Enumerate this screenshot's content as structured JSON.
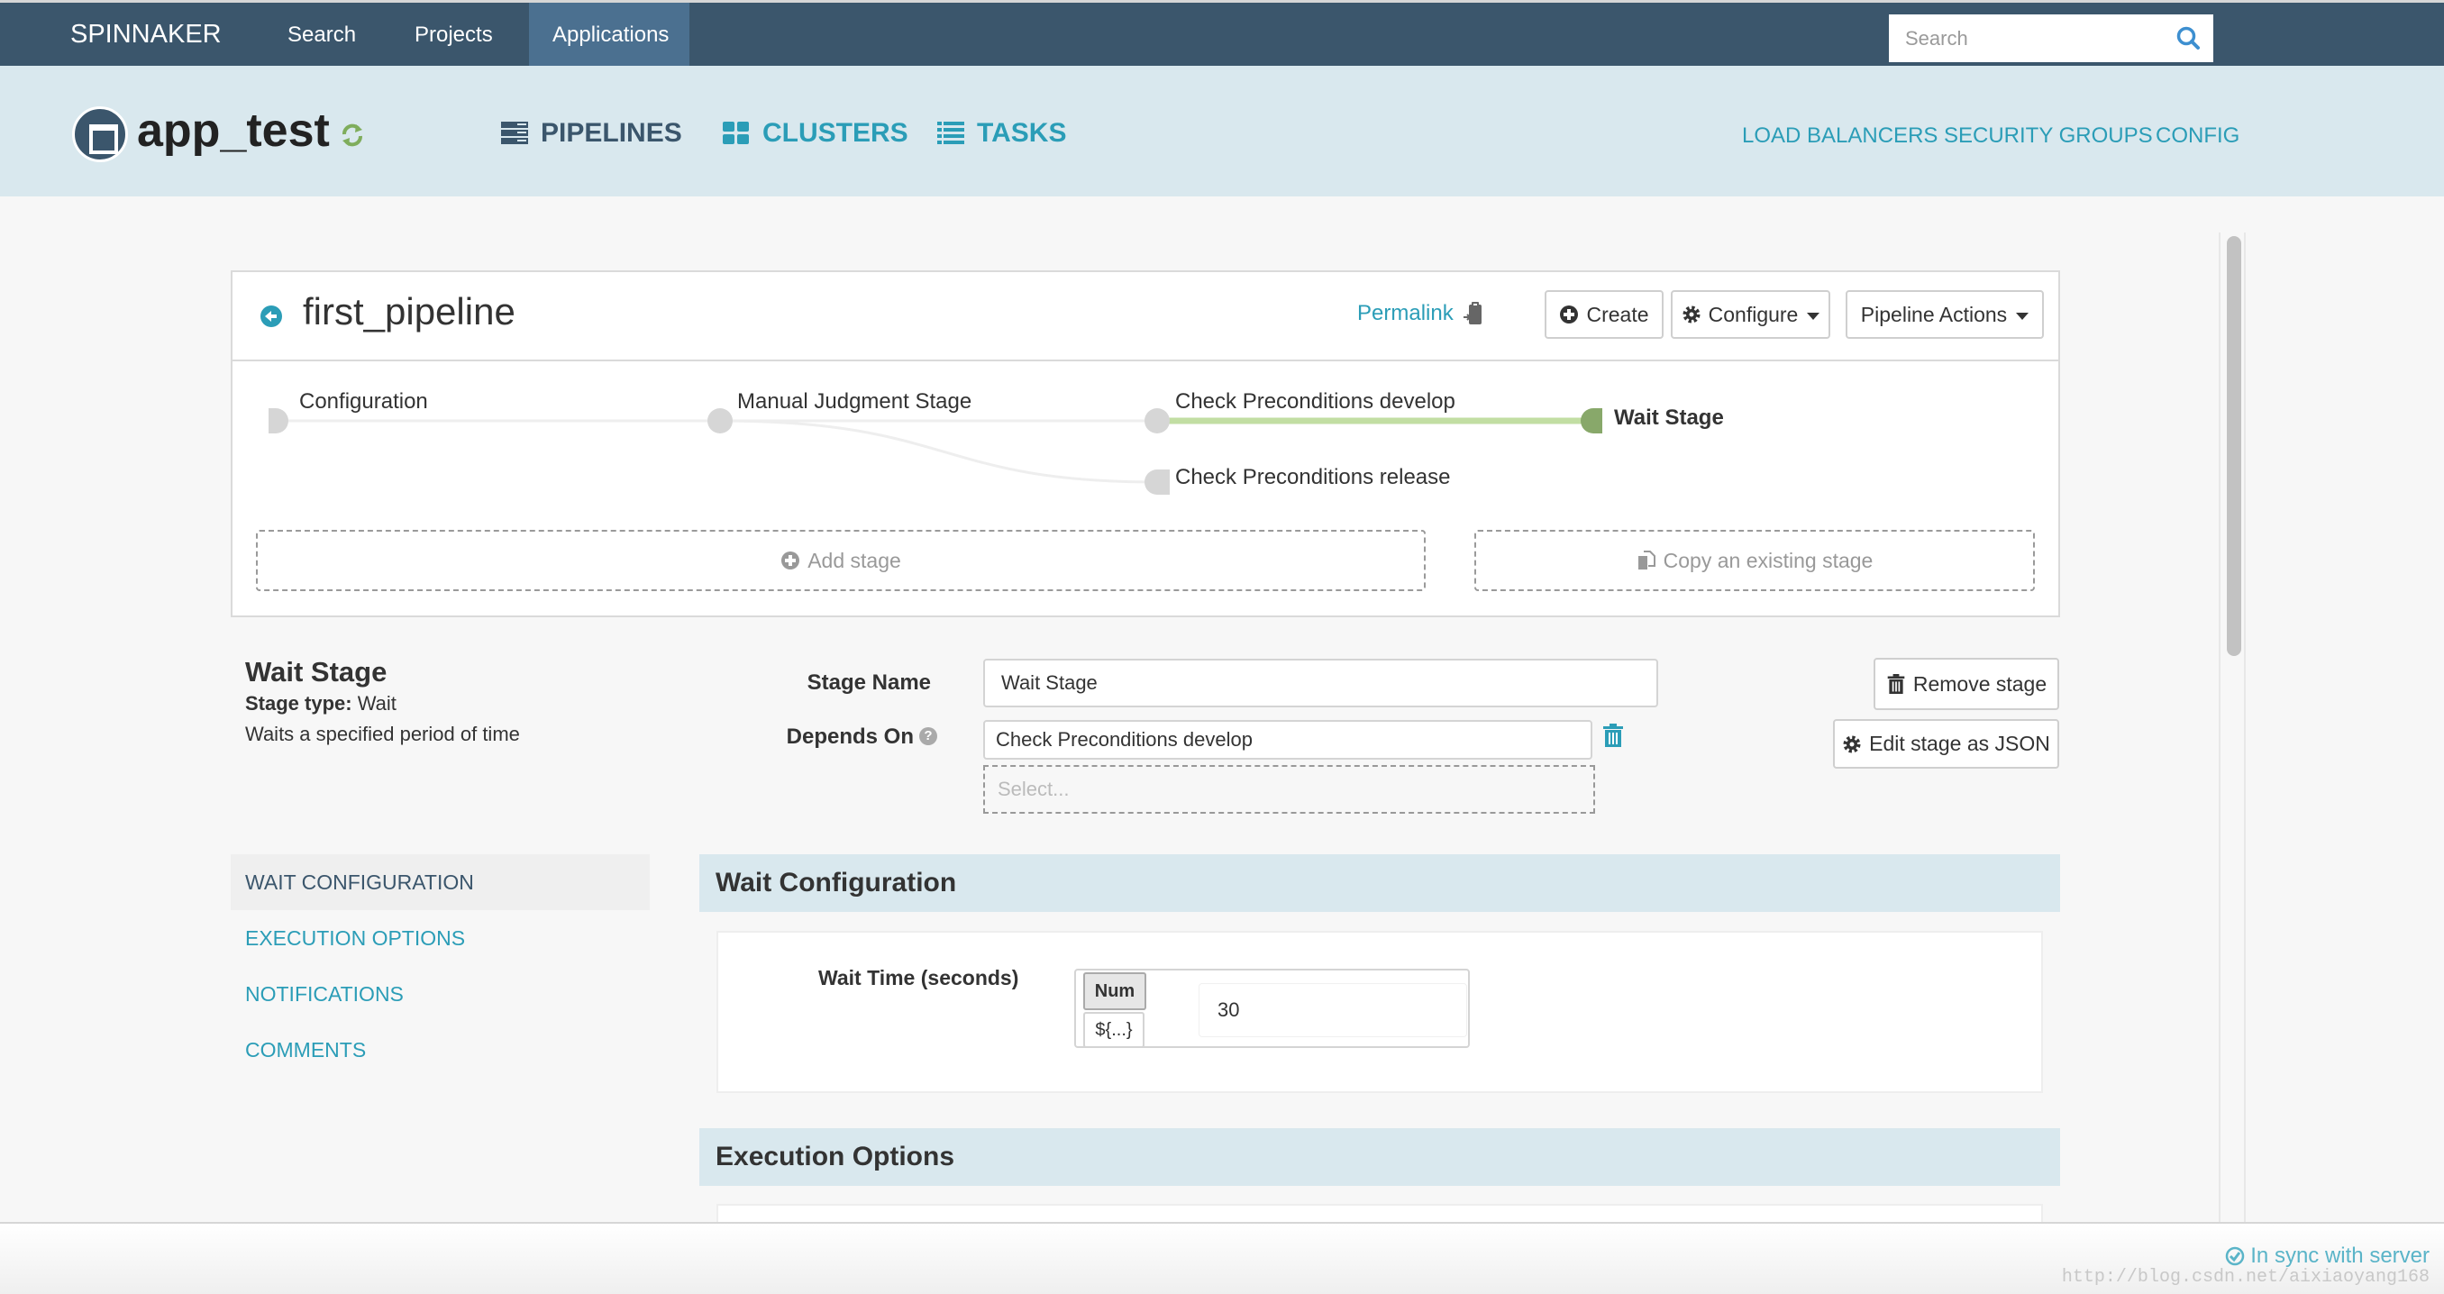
{
  "topnav": {
    "brand": "SPINNAKER",
    "links": [
      {
        "label": "Search"
      },
      {
        "label": "Projects"
      },
      {
        "label": "Applications",
        "active": true
      }
    ],
    "search_placeholder": "Search",
    "search_icon": "search-icon"
  },
  "app": {
    "name": "app_test",
    "icon": "application-icon",
    "refresh_icon": "refresh-icon",
    "tabs": [
      {
        "label": "PIPELINES",
        "icon": "pipelines-icon",
        "active": true
      },
      {
        "label": "CLUSTERS",
        "icon": "clusters-icon"
      },
      {
        "label": "TASKS",
        "icon": "tasks-icon"
      }
    ],
    "right_links": [
      "LOAD BALANCERS",
      "SECURITY GROUPS",
      "CONFIG"
    ]
  },
  "pipeline": {
    "name": "first_pipeline",
    "permalink_label": "Permalink",
    "create_label": "Create",
    "configure_label": "Configure",
    "actions_label": "Pipeline Actions",
    "stages": [
      {
        "label": "Configuration",
        "column": 0,
        "row": 0
      },
      {
        "label": "Manual Judgment Stage",
        "column": 1,
        "row": 0
      },
      {
        "label": "Check Preconditions develop",
        "column": 2,
        "row": 0
      },
      {
        "label": "Check Preconditions release",
        "column": 2,
        "row": 1
      },
      {
        "label": "Wait Stage",
        "column": 3,
        "row": 0,
        "selected": true
      }
    ],
    "add_stage_label": "Add stage",
    "copy_stage_label": "Copy an existing stage"
  },
  "stage": {
    "title": "Wait Stage",
    "type_label": "Stage type:",
    "type_value": "Wait",
    "description": "Waits a specified period of time",
    "stage_name_label": "Stage Name",
    "stage_name_value": "Wait Stage",
    "depends_on_label": "Depends On",
    "depends_on_value": "Check Preconditions develop",
    "select_placeholder": "Select...",
    "remove_label": "Remove stage",
    "edit_json_label": "Edit stage as JSON"
  },
  "sidebar": {
    "items": [
      {
        "label": "WAIT CONFIGURATION",
        "active": true
      },
      {
        "label": "EXECUTION OPTIONS"
      },
      {
        "label": "NOTIFICATIONS"
      },
      {
        "label": "COMMENTS"
      }
    ]
  },
  "sections": {
    "wait_config_title": "Wait Configuration",
    "wait_time_label": "Wait Time (seconds)",
    "toggle_num": "Num",
    "toggle_expr": "${...}",
    "wait_time_value": "30",
    "execution_options_title": "Execution Options"
  },
  "footer": {
    "sync_status": "In sync with server",
    "watermark": "http://blog.csdn.net/aixiaoyang168"
  },
  "colors": {
    "nav_bg": "#3b566c",
    "nav_active": "#4b7090",
    "header_bg": "#d9e8ee",
    "link": "#2b9db7",
    "stage_selected": "#88a86a",
    "stage_edge_active": "#c2dea3",
    "node_default": "#d6d6d6"
  }
}
